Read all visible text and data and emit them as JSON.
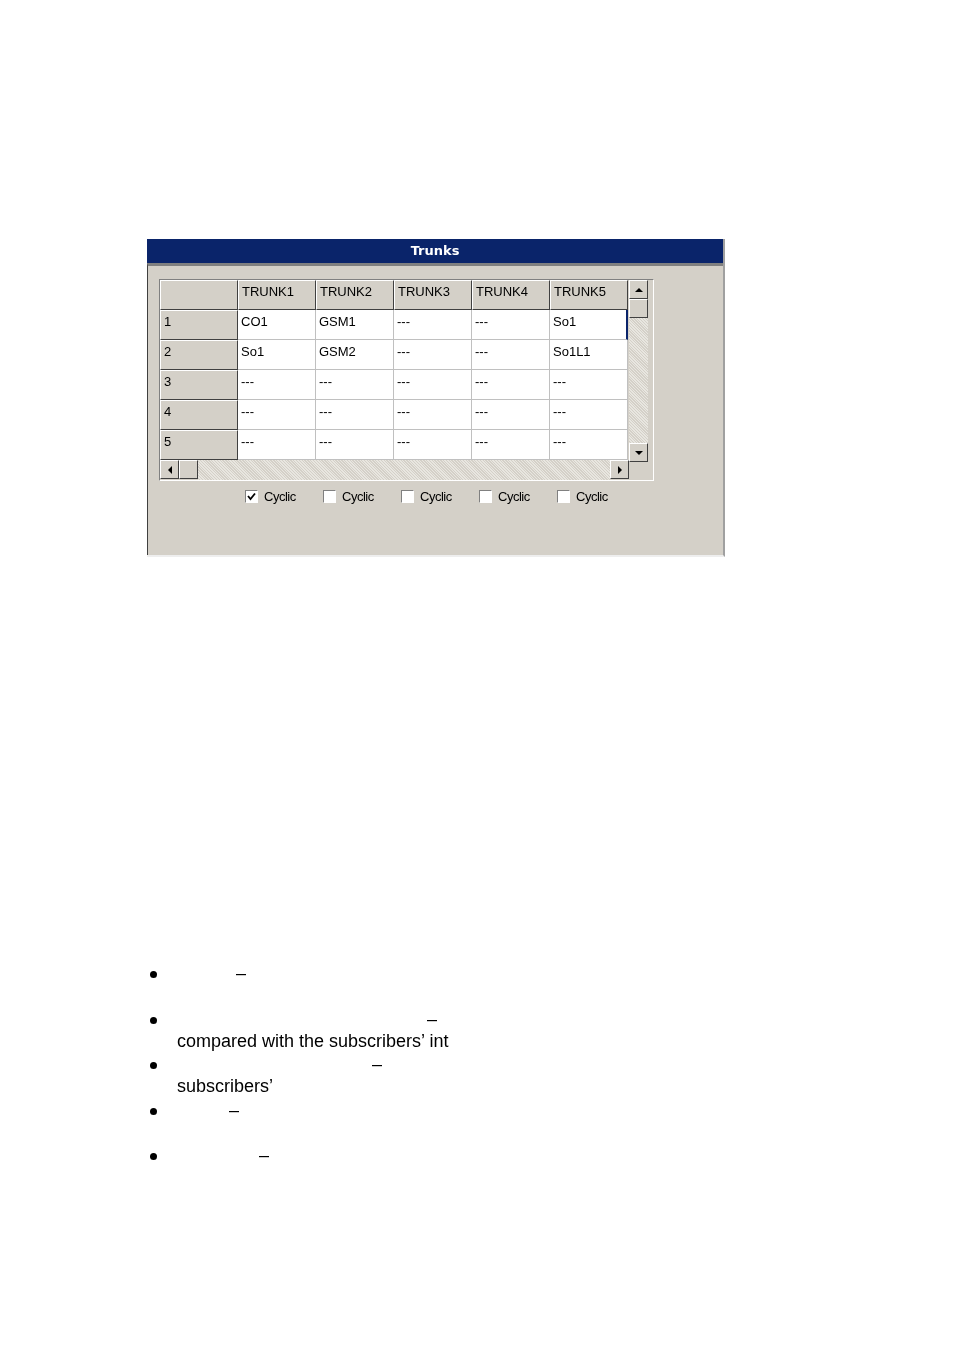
{
  "window": {
    "title": "Trunks"
  },
  "grid": {
    "columns": [
      "TRUNK1",
      "TRUNK2",
      "TRUNK3",
      "TRUNK4",
      "TRUNK5"
    ],
    "rows": [
      {
        "header": "1",
        "cells": [
          "CO1",
          "GSM1",
          "---",
          "---",
          "So1"
        ]
      },
      {
        "header": "2",
        "cells": [
          "So1",
          "GSM2",
          "---",
          "---",
          "So1L1"
        ]
      },
      {
        "header": "3",
        "cells": [
          "---",
          "---",
          "---",
          "---",
          "---"
        ]
      },
      {
        "header": "4",
        "cells": [
          "---",
          "---",
          "---",
          "---",
          "---"
        ]
      },
      {
        "header": "5",
        "cells": [
          "---",
          "---",
          "---",
          "---",
          "---"
        ]
      }
    ]
  },
  "checkboxes": [
    {
      "label": "Cyclic",
      "checked": true
    },
    {
      "label": "Cyclic",
      "checked": false
    },
    {
      "label": "Cyclic",
      "checked": false
    },
    {
      "label": "Cyclic",
      "checked": false
    },
    {
      "label": "Cyclic",
      "checked": false
    }
  ],
  "bullets": [
    {
      "dash": "–"
    },
    {
      "dash": "–",
      "text": "compared with the subscribers’ int"
    },
    {
      "dash": "–",
      "text": "subscribers’"
    },
    {
      "dash": "–"
    },
    {
      "dash": "–"
    }
  ]
}
